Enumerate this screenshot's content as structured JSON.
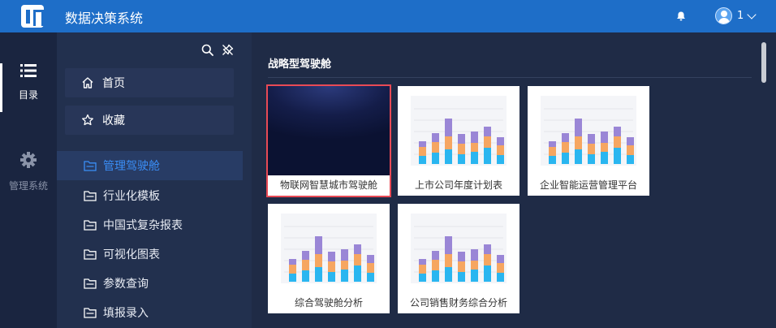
{
  "app": {
    "title": "数据决策系统",
    "user": "1"
  },
  "rail": {
    "items": [
      {
        "label": "目录",
        "icon": "list-icon",
        "active": true
      },
      {
        "label": "管理系统",
        "icon": "gear-icon",
        "active": false
      }
    ]
  },
  "nav": {
    "top_buttons": [
      {
        "label": "首页",
        "icon": "home-icon"
      },
      {
        "label": "收藏",
        "icon": "star-icon"
      }
    ],
    "folders": [
      {
        "label": "管理驾驶舱",
        "active": true
      },
      {
        "label": "行业化模板",
        "active": false
      },
      {
        "label": "中国式复杂报表",
        "active": false
      },
      {
        "label": "可视化图表",
        "active": false
      },
      {
        "label": "参数查询",
        "active": false
      },
      {
        "label": "填报录入",
        "active": false
      }
    ]
  },
  "content": {
    "section_title": "战略型驾驶舱",
    "cards": [
      {
        "name": "物联网智慧城市驾驶舱",
        "thumb": "dark",
        "selected": true
      },
      {
        "name": "上市公司年度计划表",
        "thumb": "chart",
        "selected": false
      },
      {
        "name": "企业智能运营管理平台",
        "thumb": "chart",
        "selected": false
      },
      {
        "name": "综合驾驶舱分析",
        "thumb": "chart",
        "selected": false
      },
      {
        "name": "公司销售财务综合分析",
        "thumb": "chart",
        "selected": false
      }
    ]
  },
  "colors": {
    "topbar": "#1e6ec8",
    "rail": "#1a2540",
    "nav": "#22304e",
    "content": "#1f2b46",
    "accent": "#3a8ef6",
    "selected_border": "#e84a55",
    "bar_blue": "#2ab6f0",
    "bar_orange": "#f6a661",
    "bar_purple": "#9a86d6"
  }
}
